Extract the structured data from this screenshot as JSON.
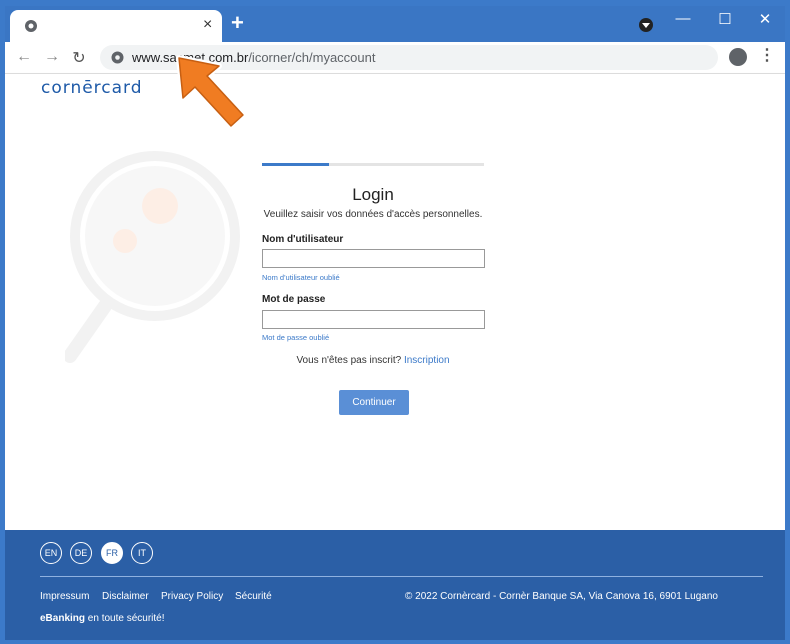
{
  "browser": {
    "tab_close": "×",
    "new_tab": "+",
    "window_controls": {
      "minimize": "—",
      "maximize": "☐",
      "close": "✕"
    },
    "nav": {
      "back": "←",
      "forward": "→",
      "reload": "↻"
    },
    "url_host": "www.sasmet.com.br",
    "url_path": "/icorner/ch/myaccount",
    "menu": "⋮"
  },
  "header": {
    "logo": "cornērcard",
    "brand_color": "#1e5aa8"
  },
  "login": {
    "progress": 0.3,
    "title": "Login",
    "subtitle": "Veuillez saisir vos données d'accès personnelles.",
    "username_label": "Nom d'utilisateur",
    "username_value": "",
    "forgot_username": "Nom d'utilisateur oublié",
    "password_label": "Mot de passe",
    "password_value": "",
    "forgot_password": "Mot de passe oublié",
    "signup_prompt": "Vous n'êtes pas inscrit?",
    "signup_link": "Inscription",
    "continue_label": "Continuer"
  },
  "footer": {
    "languages": [
      "EN",
      "DE",
      "FR",
      "IT"
    ],
    "active_language": "FR",
    "links": [
      "Impressum",
      "Disclaimer",
      "Privacy Policy",
      "Sécurité"
    ],
    "copyright": "© 2022 Cornèrcard - Cornèr Banque SA, Via Canova 16, 6901 Lugano",
    "ebanking_brand": "eBanking",
    "ebanking_tagline": "en toute sécurité!",
    "background_color": "#2b5fa6"
  },
  "annotation": {
    "arrow_color": "#f07c22"
  }
}
